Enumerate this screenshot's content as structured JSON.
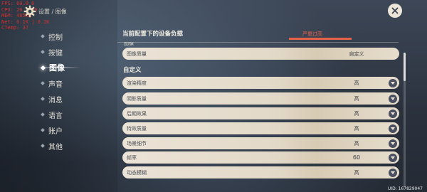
{
  "debug_overlay": {
    "lines": [
      "FPS: 60.0  0",
      "CPU: 26 | 29",
      "MEM: 485MB",
      "Net: 0.1K | 0.2K",
      "CTemp: 37"
    ]
  },
  "header": {
    "breadcrumb": "设置 / 图像",
    "close_icon": "close-x"
  },
  "sidebar": {
    "items": [
      {
        "label": "控制",
        "active": false
      },
      {
        "label": "按键",
        "active": false
      },
      {
        "label": "图像",
        "active": true
      },
      {
        "label": "声音",
        "active": false
      },
      {
        "label": "消息",
        "active": false
      },
      {
        "label": "语言",
        "active": false
      },
      {
        "label": "账户",
        "active": false
      },
      {
        "label": "其他",
        "active": false
      }
    ]
  },
  "device_load": {
    "title": "当前配置下的设备负载",
    "status": "严重过高",
    "level": 1.0,
    "status_color": "#e6634a"
  },
  "sections": {
    "image_peek": "图像",
    "custom_title": "自定义"
  },
  "settings": {
    "quality": {
      "label": "图像质量",
      "value": "自定义"
    },
    "custom": [
      {
        "label": "渲染精度",
        "value": "高"
      },
      {
        "label": "阴影质量",
        "value": "高"
      },
      {
        "label": "后期效果",
        "value": "高"
      },
      {
        "label": "特效质量",
        "value": "高"
      },
      {
        "label": "场景细节",
        "value": "高"
      },
      {
        "label": "帧率",
        "value": "60"
      },
      {
        "label": "动态模糊",
        "value": "高"
      }
    ]
  },
  "footer": {
    "uid": "UID: 167829047"
  },
  "colors": {
    "accent_warning": "#e6634a",
    "row_bg": "#ebe3d6",
    "arrow_button": "#4a5060"
  }
}
